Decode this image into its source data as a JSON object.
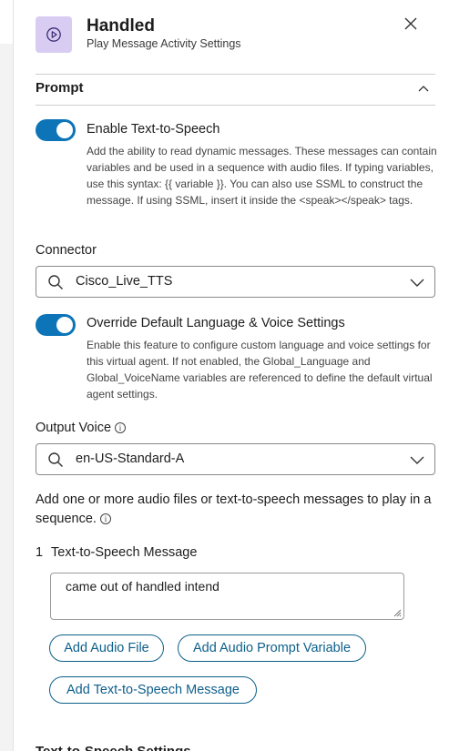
{
  "header": {
    "title": "Handled",
    "subtitle": "Play Message Activity Settings",
    "icon": "play-circle-icon",
    "icon_bg": "#d9ccf2"
  },
  "prompt_section": {
    "title": "Prompt",
    "tts_toggle": {
      "label": "Enable Text-to-Speech",
      "on": true,
      "help": "Add the ability to read dynamic messages. These messages can contain variables and be used in a sequence with audio files. If typing variables, use this syntax: {{ variable }}. You can also use SSML to construct the message. If using SSML, insert it inside the <speak></speak> tags."
    },
    "connector": {
      "label": "Connector",
      "value": "Cisco_Live_TTS"
    },
    "override_toggle": {
      "label": "Override Default Language & Voice Settings",
      "on": true,
      "help": "Enable this feature to configure custom language and voice settings for this virtual agent. If not enabled, the Global_Language and Global_VoiceName variables are referenced to define the default virtual agent settings."
    },
    "output_voice": {
      "label": "Output Voice",
      "value": "en-US-Standard-A"
    },
    "sequence_text": "Add one or more audio files or text-to-speech messages to play in a sequence.",
    "step": {
      "number": "1",
      "title": "Text-to-Speech Message",
      "message": "came out of handled intend"
    },
    "buttons": {
      "add_audio_file": "Add Audio File",
      "add_audio_prompt_variable": "Add Audio Prompt Variable",
      "add_tts_message": "Add Text-to-Speech Message"
    },
    "next_section_title": "Text-to-Speech Settings"
  },
  "colors": {
    "accent": "#0d74b8",
    "button_text": "#0d5f8a"
  }
}
